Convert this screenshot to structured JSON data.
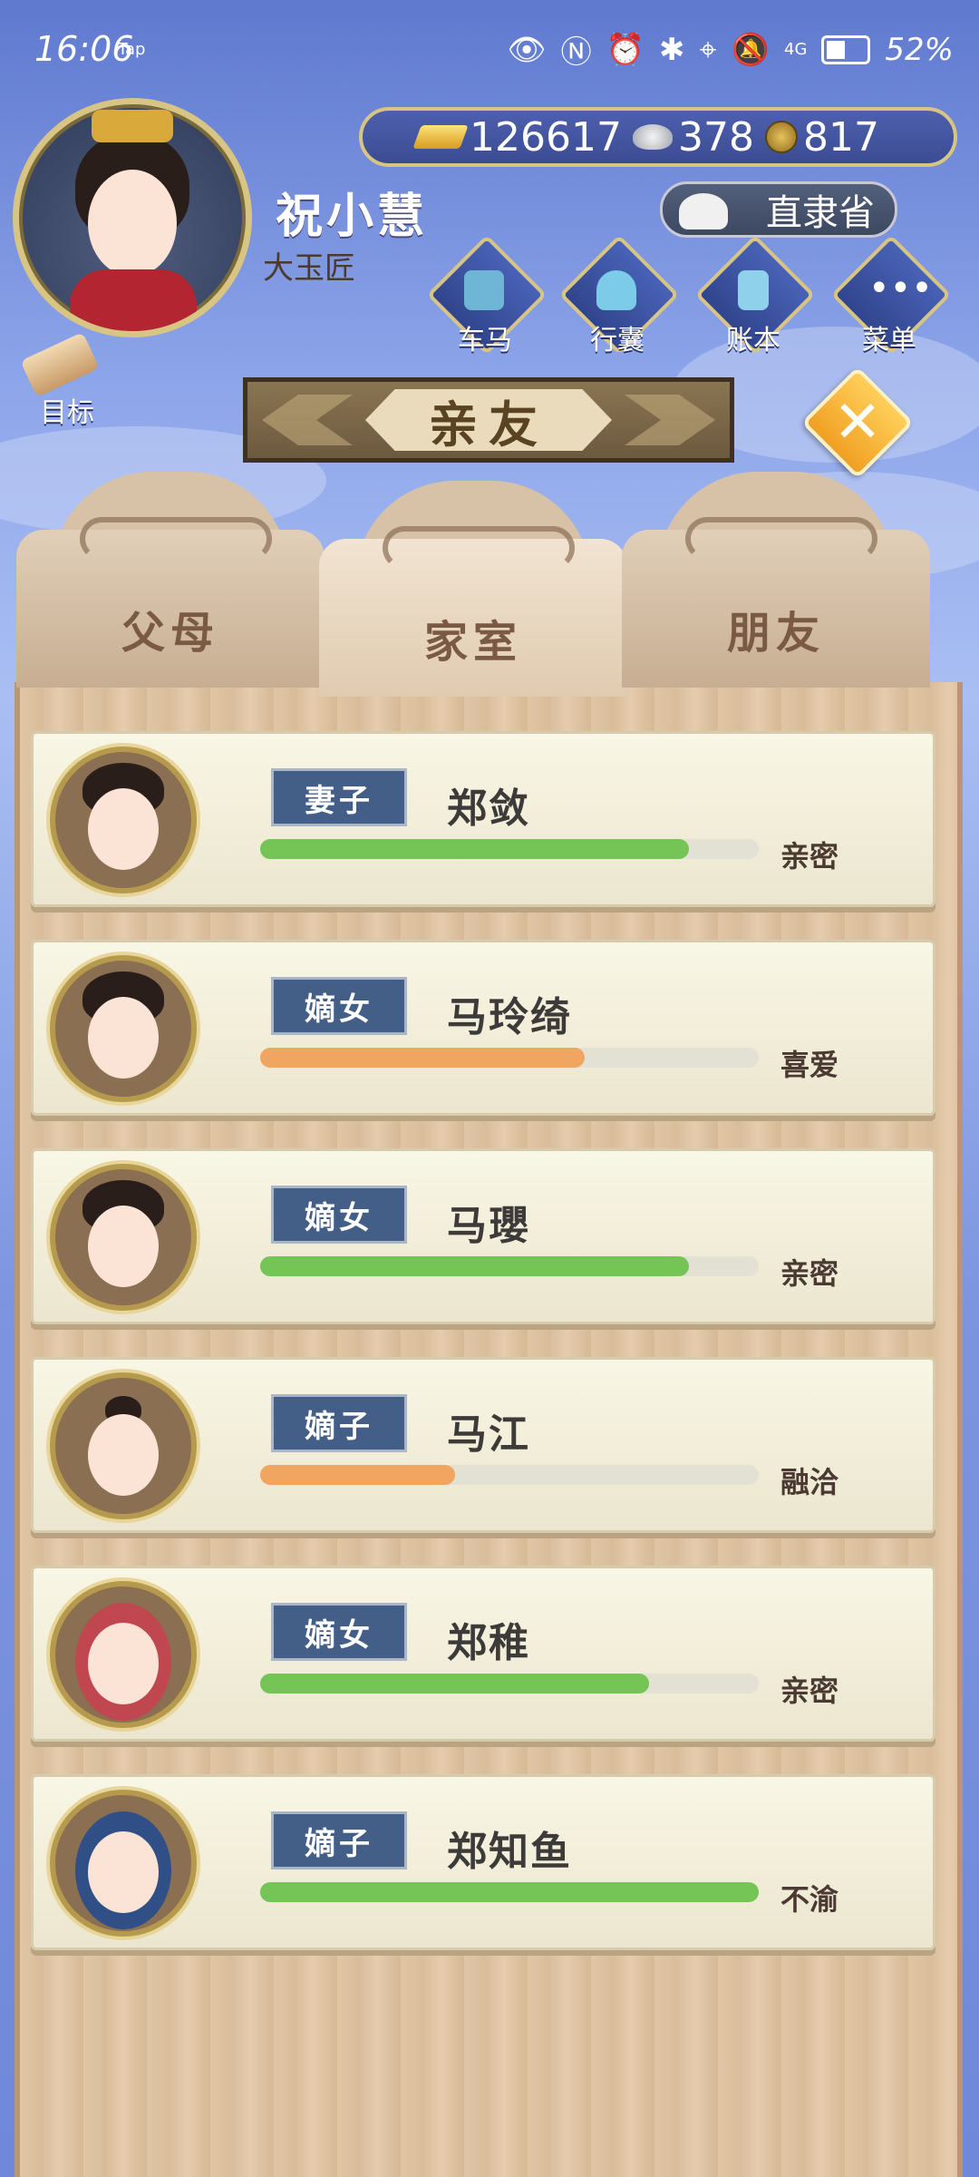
{
  "status_bar": {
    "time": "16:06",
    "tap_label": "Tap",
    "battery": "52%",
    "network": "4G"
  },
  "player": {
    "name": "祝小慧",
    "title": "大玉匠"
  },
  "currency": [
    {
      "name": "gold-ingot",
      "value": "126617"
    },
    {
      "name": "silver-ingot",
      "value": "378"
    },
    {
      "name": "copper-coin",
      "value": "817"
    }
  ],
  "location": "直隶省",
  "nav": [
    {
      "label": "车马",
      "icon": "carriage-icon"
    },
    {
      "label": "行囊",
      "icon": "bundle-icon"
    },
    {
      "label": "账本",
      "icon": "ledger-icon"
    },
    {
      "label": "菜单",
      "icon": "menu-icon"
    }
  ],
  "goal_label": "目标",
  "panel_title": "亲友",
  "tabs": [
    {
      "label": "父母",
      "active": false
    },
    {
      "label": "家室",
      "active": true
    },
    {
      "label": "朋友",
      "active": false
    }
  ],
  "members": [
    {
      "role": "妻子",
      "name": "郑敛",
      "relationship": "亲密",
      "affinity": 0.86,
      "bar_color": "#74c556"
    },
    {
      "role": "嫡女",
      "name": "马玲绮",
      "relationship": "喜爱",
      "affinity": 0.65,
      "bar_color": "#f0a561"
    },
    {
      "role": "嫡女",
      "name": "马瓔",
      "relationship": "亲密",
      "affinity": 0.86,
      "bar_color": "#74c556"
    },
    {
      "role": "嫡子",
      "name": "马江",
      "relationship": "融洽",
      "affinity": 0.39,
      "bar_color": "#f0a561"
    },
    {
      "role": "嫡女",
      "name": "郑稚",
      "relationship": "亲密",
      "affinity": 0.78,
      "bar_color": "#74c556"
    },
    {
      "role": "嫡子",
      "name": "郑知鱼",
      "relationship": "不渝",
      "affinity": 1.0,
      "bar_color": "#74c556"
    }
  ]
}
